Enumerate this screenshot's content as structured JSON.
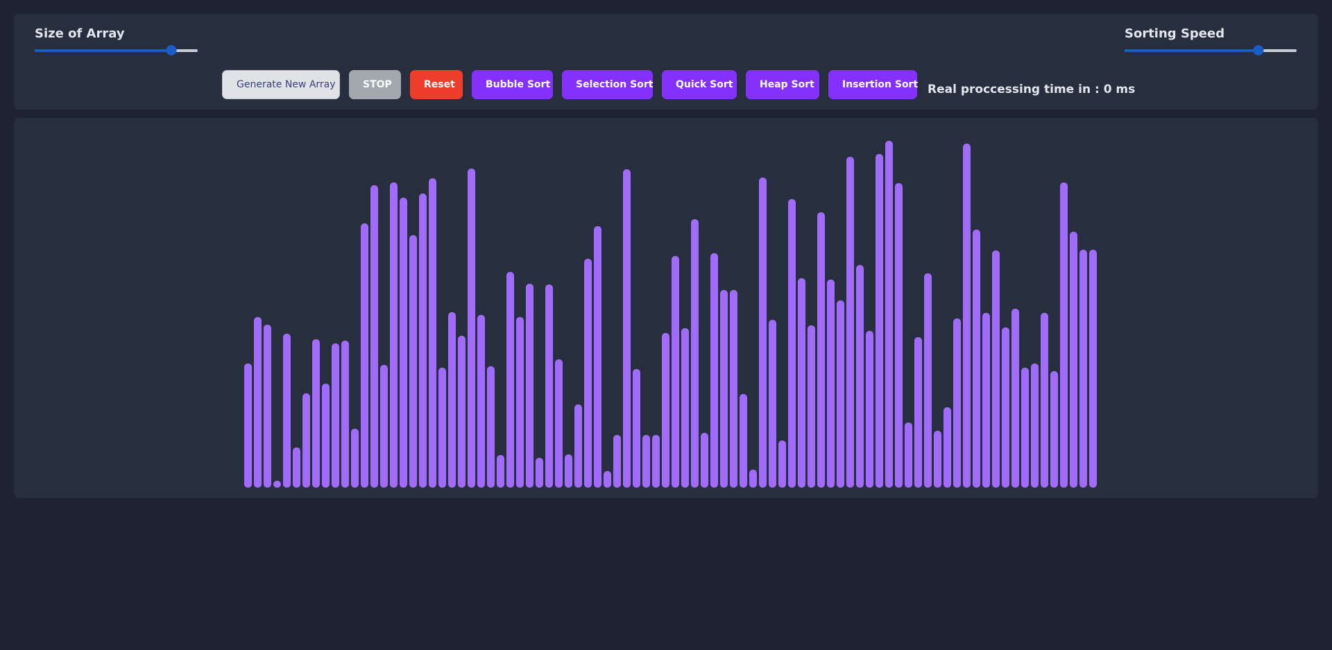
{
  "controls": {
    "size_label": "Size of Array",
    "size_value": 0.84,
    "speed_label": "Sorting Speed",
    "speed_value": 0.78,
    "buttons": {
      "generate": "Generate New Array",
      "stop": "STOP",
      "reset": "Reset",
      "bubble": "Bubble Sort",
      "selection": "Selection Sort",
      "quick": "Quick Sort",
      "heap": "Heap Sort",
      "insertion": "Insertion Sort"
    },
    "time_text": "Real proccessing time in : 0 ms"
  },
  "colors": {
    "bar": "#a06cf9",
    "accent_purple": "#8430ff",
    "reset_red": "#ee3d2b",
    "slider_blue": "#1a5cc8"
  },
  "array": {
    "max": 500,
    "values": [
      179,
      246,
      235,
      8,
      222,
      58,
      136,
      214,
      150,
      208,
      212,
      85,
      381,
      436,
      177,
      440,
      418,
      364,
      424,
      446,
      173,
      253,
      219,
      460,
      249,
      175,
      47,
      311,
      246,
      294,
      43,
      293,
      185,
      48,
      120,
      330,
      377,
      24,
      76,
      459,
      171,
      76,
      76,
      223,
      334,
      230,
      387,
      79,
      338,
      285,
      285,
      135,
      26,
      447,
      242,
      68,
      416,
      302,
      234,
      397,
      300,
      270,
      477,
      321,
      226,
      481,
      500,
      439,
      94,
      217,
      309,
      82,
      116,
      244,
      496,
      372,
      252,
      342,
      231,
      258,
      173,
      179,
      252,
      168,
      440,
      369,
      343,
      343
    ]
  }
}
